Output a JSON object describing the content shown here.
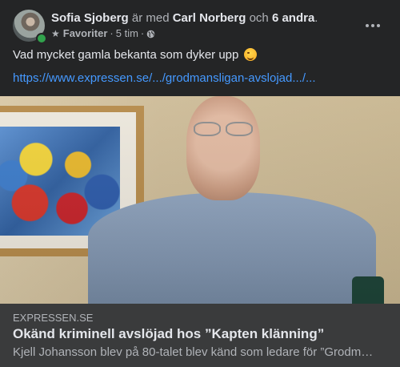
{
  "post": {
    "author": "Sofia Sjoberg",
    "with_text": "är med",
    "tagged_person": "Carl Norberg",
    "and_text": "och",
    "others": "6 andra",
    "period": ".",
    "favorite_label": "Favoriter",
    "separator": "·",
    "time": "5 tim",
    "text": "Vad mycket gamla bekanta som dyker upp",
    "link_text": "https://www.expressen.se/.../grodmansligan-avslojad.../..."
  },
  "link_preview": {
    "domain": "EXPRESSEN.SE",
    "title": "Okänd kriminell avslöjad hos ”Kapten klänning”",
    "description": "Kjell Johansson blev på 80-talet blev känd som ledare för ”Grodm…"
  },
  "colors": {
    "background": "#242526",
    "link": "#4599ff",
    "preview_background": "#3a3b3c",
    "online": "#31a24c"
  },
  "icons": [
    "star-icon",
    "globe-icon",
    "more-options-icon",
    "wink-emoji-icon"
  ]
}
